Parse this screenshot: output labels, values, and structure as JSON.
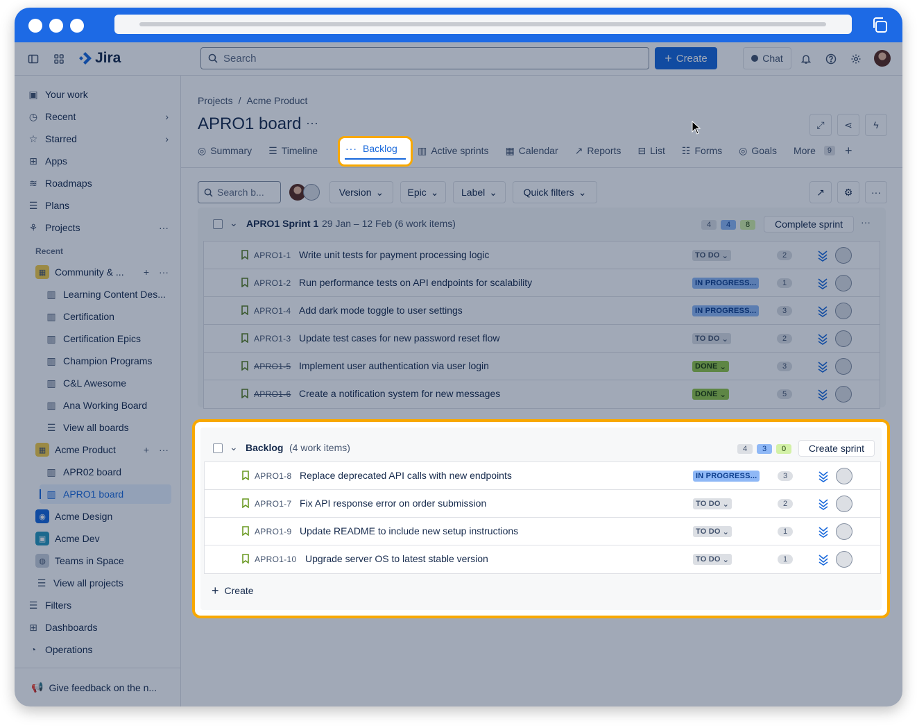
{
  "topbar": {
    "app_name": "Jira",
    "search_placeholder": "Search",
    "create_label": "Create",
    "chat_label": "Chat"
  },
  "sidebar": {
    "items": [
      {
        "label": "Your work",
        "icon": "your-work-icon"
      },
      {
        "label": "Recent",
        "icon": "clock-icon"
      },
      {
        "label": "Starred",
        "icon": "star-icon"
      },
      {
        "label": "Apps",
        "icon": "apps-icon"
      },
      {
        "label": "Roadmaps",
        "icon": "roadmaps-icon"
      },
      {
        "label": "Plans",
        "icon": "plans-icon"
      },
      {
        "label": "Projects",
        "icon": "projects-icon"
      }
    ],
    "recent_heading": "Recent",
    "spaces": [
      {
        "label": "Community & ...",
        "boards": [
          "Learning Content Des...",
          "Certification",
          "Certification Epics",
          "Champion Programs",
          "C&L Awesome",
          "Ana Working Board"
        ],
        "view_all": "View all boards"
      },
      {
        "label": "Acme Product",
        "boards": [
          "APR02 board",
          "APRO1 board"
        ]
      }
    ],
    "other_spaces": [
      "Acme Design",
      "Acme Dev",
      "Teams in Space"
    ],
    "view_all_projects": "View all projects",
    "bottom_items": [
      "Filters",
      "Dashboards",
      "Operations"
    ],
    "feedback": "Give feedback on the n..."
  },
  "main": {
    "breadcrumb": [
      "Projects",
      "Acme Product"
    ],
    "title": "APRO1 board",
    "tabs": [
      "Summary",
      "Timeline",
      "Backlog",
      "Active sprints",
      "Calendar",
      "Reports",
      "List",
      "Forms",
      "Goals",
      "More"
    ],
    "more_count": "9",
    "filters": {
      "search_placeholder": "Search b...",
      "version": "Version",
      "epic": "Epic",
      "label": "Label",
      "quick_filters": "Quick filters"
    }
  },
  "sprint": {
    "name": "APRO1 Sprint 1",
    "dates": "29 Jan – 12 Feb (6 work items)",
    "counts": [
      "4",
      "4",
      "8"
    ],
    "action": "Complete sprint",
    "rows": [
      {
        "key": "APRO1-1",
        "summary": "Write unit tests for payment processing logic",
        "status": "TO DO",
        "points": "2",
        "done": false
      },
      {
        "key": "APRO1-2",
        "summary": "Run performance tests on API endpoints for scalability",
        "status": "IN PROGRESS...",
        "points": "1",
        "done": false
      },
      {
        "key": "APRO1-4",
        "summary": "Add dark mode toggle to user settings",
        "status": "IN PROGRESS...",
        "points": "3",
        "done": false
      },
      {
        "key": "APRO1-3",
        "summary": "Update test cases for new password reset flow",
        "status": "TO DO",
        "points": "2",
        "done": false
      },
      {
        "key": "APRO1-5",
        "summary": "Implement user authentication via user login",
        "status": "DONE",
        "points": "3",
        "done": true
      },
      {
        "key": "APRO1-6",
        "summary": "Create a notification system for new messages",
        "status": "DONE",
        "points": "5",
        "done": true
      }
    ]
  },
  "backlog": {
    "name": "Backlog",
    "count_label": "(4 work items)",
    "counts": [
      "4",
      "3",
      "0"
    ],
    "action": "Create sprint",
    "create_label": "Create",
    "rows": [
      {
        "key": "APRO1-8",
        "summary": "Replace deprecated API calls with new endpoints",
        "status": "IN PROGRESS...",
        "points": "3"
      },
      {
        "key": "APRO1-7",
        "summary": "Fix API response error on order submission",
        "status": "TO DO",
        "points": "2"
      },
      {
        "key": "APRO1-9",
        "summary": "Update README to include new setup instructions",
        "status": "TO DO",
        "points": "1"
      },
      {
        "key": "APRO1-10",
        "summary": "Upgrade server OS to latest stable version",
        "status": "TO DO",
        "points": "1"
      }
    ]
  },
  "colors": {
    "brand": "#1868db",
    "highlight": "#f8a800",
    "status_done": "#94c748",
    "status_progress": "#8fb8f6"
  }
}
